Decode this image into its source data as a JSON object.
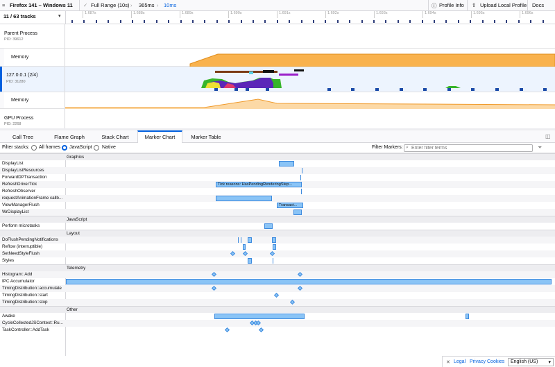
{
  "topbar": {
    "profile_name": "Firefox 141 – Windows 11",
    "breadcrumbs": [
      "Full Range (10s)",
      "365ms",
      "10ms"
    ],
    "profile_info": "Profile Info",
    "upload": "Upload Local Profile",
    "docs": "Docs"
  },
  "tracks": {
    "count_label": "11 / 63 tracks",
    "ticks": [
      "1.687s",
      "1.688s",
      "1.689s",
      "1.690s",
      "1.691s",
      "1.692s",
      "1.693s",
      "1.694s",
      "1.695s",
      "1.696s"
    ],
    "rows": [
      {
        "name": "Parent Process",
        "pid": "PID: 39612"
      },
      {
        "name": "Memory",
        "pid": ""
      },
      {
        "name": "127.0.0.1 (2/4)",
        "pid": "PID: 31280"
      },
      {
        "name": "Memory",
        "pid": ""
      },
      {
        "name": "GPU Process",
        "pid": "PID: 2268"
      }
    ]
  },
  "tabs": [
    "Call Tree",
    "Flame Graph",
    "Stack Chart",
    "Marker Chart",
    "Marker Table"
  ],
  "selected_tab": "Marker Chart",
  "filter": {
    "stacks_label": "Filter stacks:",
    "options": [
      "All frames",
      "JavaScript",
      "Native"
    ],
    "selected": "JavaScript",
    "markers_label": "Filter Markers:",
    "placeholder": "Enter filter terms"
  },
  "marker_chart": {
    "categories": [
      {
        "name": "Graphics",
        "rows": [
          "DisplayList",
          "DisplayListResources",
          "ForwardDPTransaction",
          "RefreshDriverTick",
          "RefreshObserver",
          "requestAnimationFrame callb...",
          "ViewManagerFlush",
          "WrDisplayList"
        ]
      },
      {
        "name": "JavaScript",
        "rows": [
          "Perform microtasks"
        ]
      },
      {
        "name": "Layout",
        "rows": [
          "DoFlushPendingNotifications",
          "Reflow (interruptible)",
          "SetNeedStyleFlush",
          "Styles"
        ]
      },
      {
        "name": "Telemetry",
        "rows": [
          "Histogram::Add",
          "IPC Accumulator",
          "TimingDistribution::accumulate",
          "TimingDistribution::start",
          "TimingDistribution::stop"
        ]
      },
      {
        "name": "Other",
        "rows": [
          "Awake",
          "CycleCollectedJSContext::Ru...",
          "TaskController::AddTask"
        ]
      }
    ],
    "bar_labels": {
      "refresh_tick": "Tick reasons: HasPendingRenderingStep...",
      "view_manager": "Transact..."
    }
  },
  "footer": {
    "legal": "Legal",
    "privacy": "Privacy",
    "cookies": "Cookies",
    "language": "English (US)"
  },
  "colors": {
    "accent": "#0060df",
    "marker_fill": "#8ac4f6",
    "marker_border": "#3d8ade",
    "memory_fill": "#f9b24d"
  }
}
